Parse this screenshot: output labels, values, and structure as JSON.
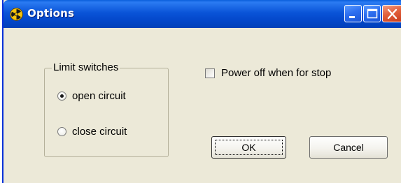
{
  "window": {
    "title": "Options",
    "icon": "radiation-icon",
    "title_buttons": [
      "minimize",
      "maximize",
      "close"
    ]
  },
  "limit_switches": {
    "legend": "Limit switches",
    "options": [
      {
        "label": "open circuit",
        "selected": true
      },
      {
        "label": "close circuit",
        "selected": false
      }
    ]
  },
  "power_off": {
    "label": "Power off when for stop",
    "checked": false
  },
  "buttons": {
    "ok": "OK",
    "cancel": "Cancel"
  },
  "colors": {
    "titlebar": "#0a54d8",
    "window_bg": "#ece9d8",
    "close_button": "#e2603c"
  }
}
